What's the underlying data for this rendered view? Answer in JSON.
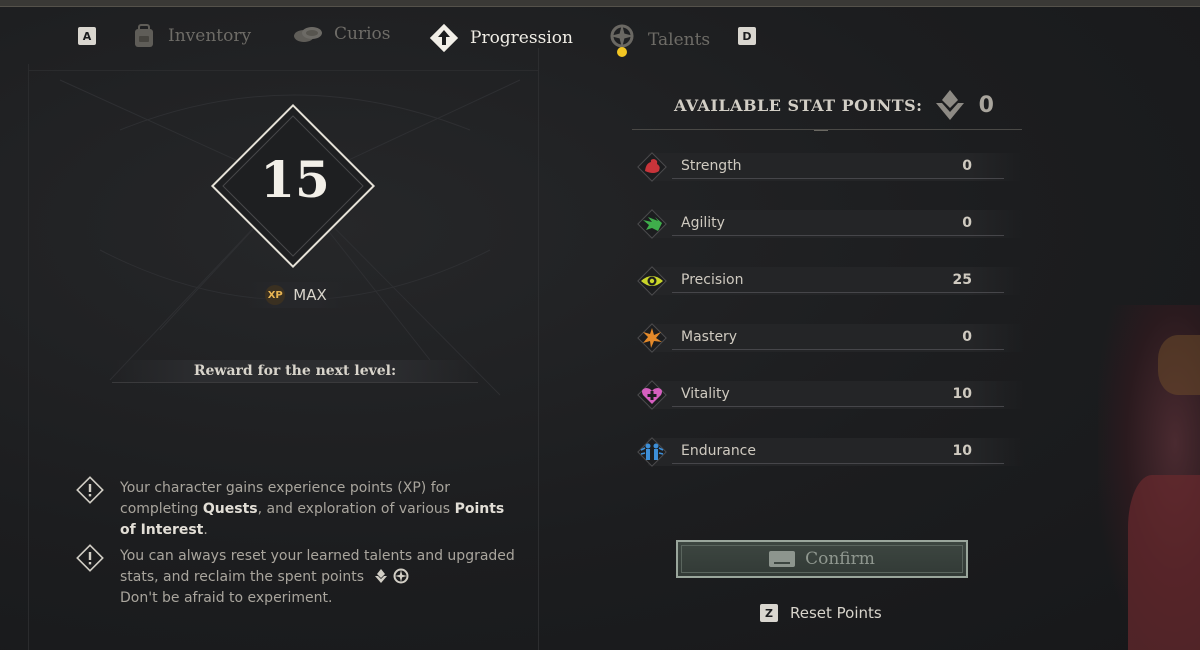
{
  "tabs": {
    "key_left": "A",
    "key_right": "D",
    "items": [
      {
        "label": "Inventory",
        "icon": "backpack-icon",
        "active": false
      },
      {
        "label": "Curios",
        "icon": "coins-icon",
        "active": false
      },
      {
        "label": "Progression",
        "icon": "arrow-up-diamond-icon",
        "active": true
      },
      {
        "label": "Talents",
        "icon": "compass-icon",
        "active": false,
        "badge": true
      }
    ]
  },
  "level": {
    "value": "15",
    "xp_label": "XP",
    "xp_value": "MAX",
    "reward_label": "Reward for the next level:"
  },
  "info": [
    {
      "pre1": "Your character gains experience points (XP) for completing ",
      "bold1": "Quests",
      "pre2": ", and exploration of various ",
      "bold2": "Points of Interest",
      "post": "."
    },
    {
      "line1": "You can always reset your learned talents and upgraded stats, and reclaim the spent points",
      "line2": "Don't be afraid to experiment."
    }
  ],
  "stats_panel": {
    "available_label": "AVAILABLE STAT POINTS:",
    "available_value": "0",
    "stats": [
      {
        "name": "Strength",
        "value": "0",
        "icon": "strength-icon",
        "color": "#c8343a"
      },
      {
        "name": "Agility",
        "value": "0",
        "icon": "agility-icon",
        "color": "#3fae4b"
      },
      {
        "name": "Precision",
        "value": "25",
        "icon": "precision-icon",
        "color": "#c9d52a"
      },
      {
        "name": "Mastery",
        "value": "0",
        "icon": "mastery-icon",
        "color": "#e3892a"
      },
      {
        "name": "Vitality",
        "value": "10",
        "icon": "vitality-icon",
        "color": "#d65fc0"
      },
      {
        "name": "Endurance",
        "value": "10",
        "icon": "endurance-icon",
        "color": "#3d8fd8"
      }
    ],
    "confirm_label": "Confirm",
    "reset_key": "Z",
    "reset_label": "Reset Points"
  }
}
